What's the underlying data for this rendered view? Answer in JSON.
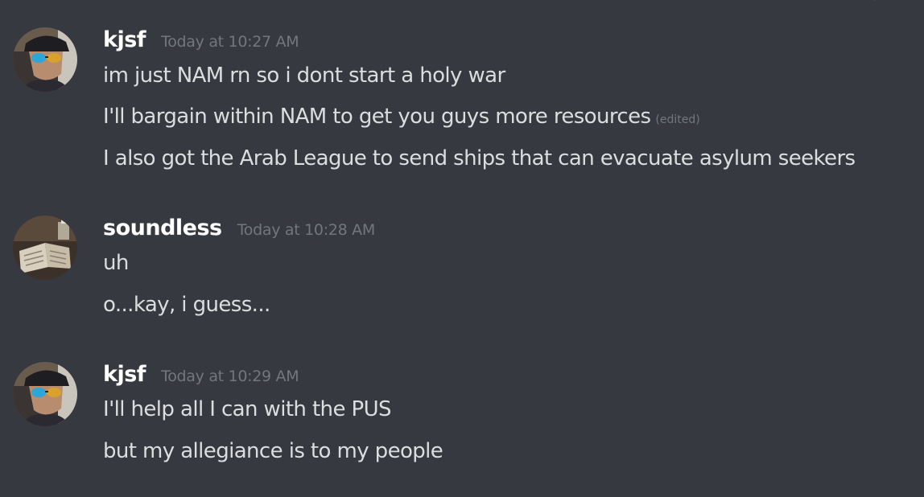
{
  "messages": [
    {
      "author": "kjsf",
      "timestamp": "Today at 10:27 AM",
      "avatar": "kjsf-avatar",
      "lines": [
        {
          "text": "im just NAM rn so i dont start a holy war"
        },
        {
          "text": "I'll bargain within NAM to get you guys more resources",
          "edited": "(edited)"
        },
        {
          "text": "I also got the Arab League to send ships that can evacuate asylum seekers"
        }
      ]
    },
    {
      "author": "soundless",
      "timestamp": "Today at 10:28 AM",
      "avatar": "soundless-avatar",
      "lines": [
        {
          "text": "uh"
        },
        {
          "text": "o...kay, i guess..."
        }
      ]
    },
    {
      "author": "kjsf",
      "timestamp": "Today at 10:29 AM",
      "avatar": "kjsf-avatar",
      "lines": [
        {
          "text": "I'll help all I can with the PUS"
        },
        {
          "text": "but my allegiance is to my people"
        }
      ]
    }
  ],
  "colors": {
    "background": "#36393f",
    "username": "#ffffff",
    "message_text": "#dcddde",
    "muted": "#72767d"
  }
}
